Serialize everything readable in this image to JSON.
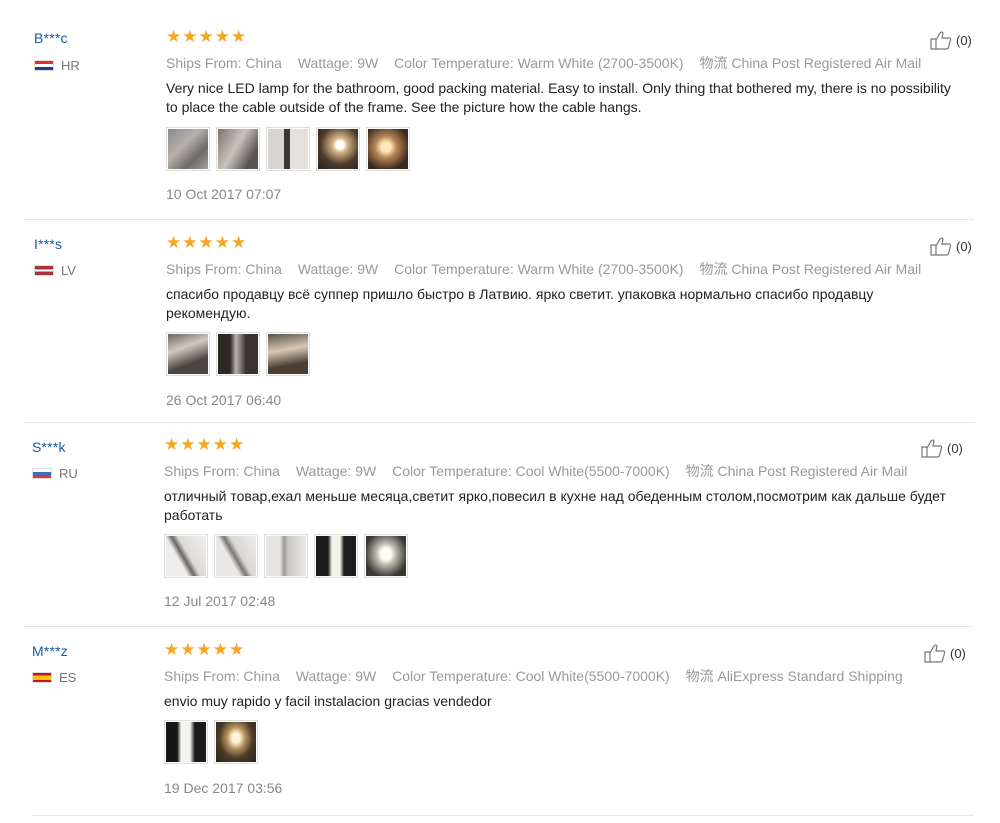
{
  "reviews": [
    {
      "user": "B***c",
      "country": "HR",
      "stars": 5,
      "ships_from_label": "Ships From:",
      "ships_from": "China",
      "wattage_label": "Wattage:",
      "wattage": "9W",
      "color_temp_label": "Color Temperature:",
      "color_temp": "Warm White (2700-3500K)",
      "logistics_label": "物流",
      "logistics": "China Post Registered Air Mail",
      "text": "Very nice LED lamp for the bathroom, good packing material. Easy to install. Only thing that bothered my, there is no possibility to place the cable outside of the frame. See the picture how the cable hangs.",
      "photo_count": 5,
      "date": "10 Oct 2017 07:07",
      "helpful": "(0)"
    },
    {
      "user": "I***s",
      "country": "LV",
      "stars": 5,
      "ships_from_label": "Ships From:",
      "ships_from": "China",
      "wattage_label": "Wattage:",
      "wattage": "9W",
      "color_temp_label": "Color Temperature:",
      "color_temp": "Warm White (2700-3500K)",
      "logistics_label": "物流",
      "logistics": "China Post Registered Air Mail",
      "text": "спасибо продавцу всё суппер пришло быстро в Латвию. ярко светит. упаковка нормально спасибо продавцу рекомендую.",
      "photo_count": 3,
      "date": "26 Oct 2017 06:40",
      "helpful": "(0)"
    },
    {
      "user": "S***k",
      "country": "RU",
      "stars": 5,
      "ships_from_label": "Ships From:",
      "ships_from": "China",
      "wattage_label": "Wattage:",
      "wattage": "9W",
      "color_temp_label": "Color Temperature:",
      "color_temp": "Cool White(5500-7000K)",
      "logistics_label": "物流",
      "logistics": "China Post Registered Air Mail",
      "text": "отличный товар,ехал меньше месяца,светит ярко,повесил в кухне над обеденным столом,посмотрим как дальше будет работать",
      "photo_count": 5,
      "date": "12 Jul 2017 02:48",
      "helpful": "(0)"
    },
    {
      "user": "M***z",
      "country": "ES",
      "stars": 5,
      "ships_from_label": "Ships From:",
      "ships_from": "China",
      "wattage_label": "Wattage:",
      "wattage": "9W",
      "color_temp_label": "Color Temperature:",
      "color_temp": "Cool White(5500-7000K)",
      "logistics_label": "物流",
      "logistics": "AliExpress Standard Shipping",
      "text": "envio muy rapido y facil instalacion gracias vendedor",
      "photo_count": 2,
      "date": "19 Dec 2017 03:56",
      "helpful": "(0)"
    }
  ],
  "icons": {
    "star": "star-icon",
    "like": "thumbs-up-icon",
    "flag": "country-flag-icon"
  },
  "colors": {
    "star": "#f5a623",
    "username": "#1a5aa6",
    "meta": "#999999"
  }
}
